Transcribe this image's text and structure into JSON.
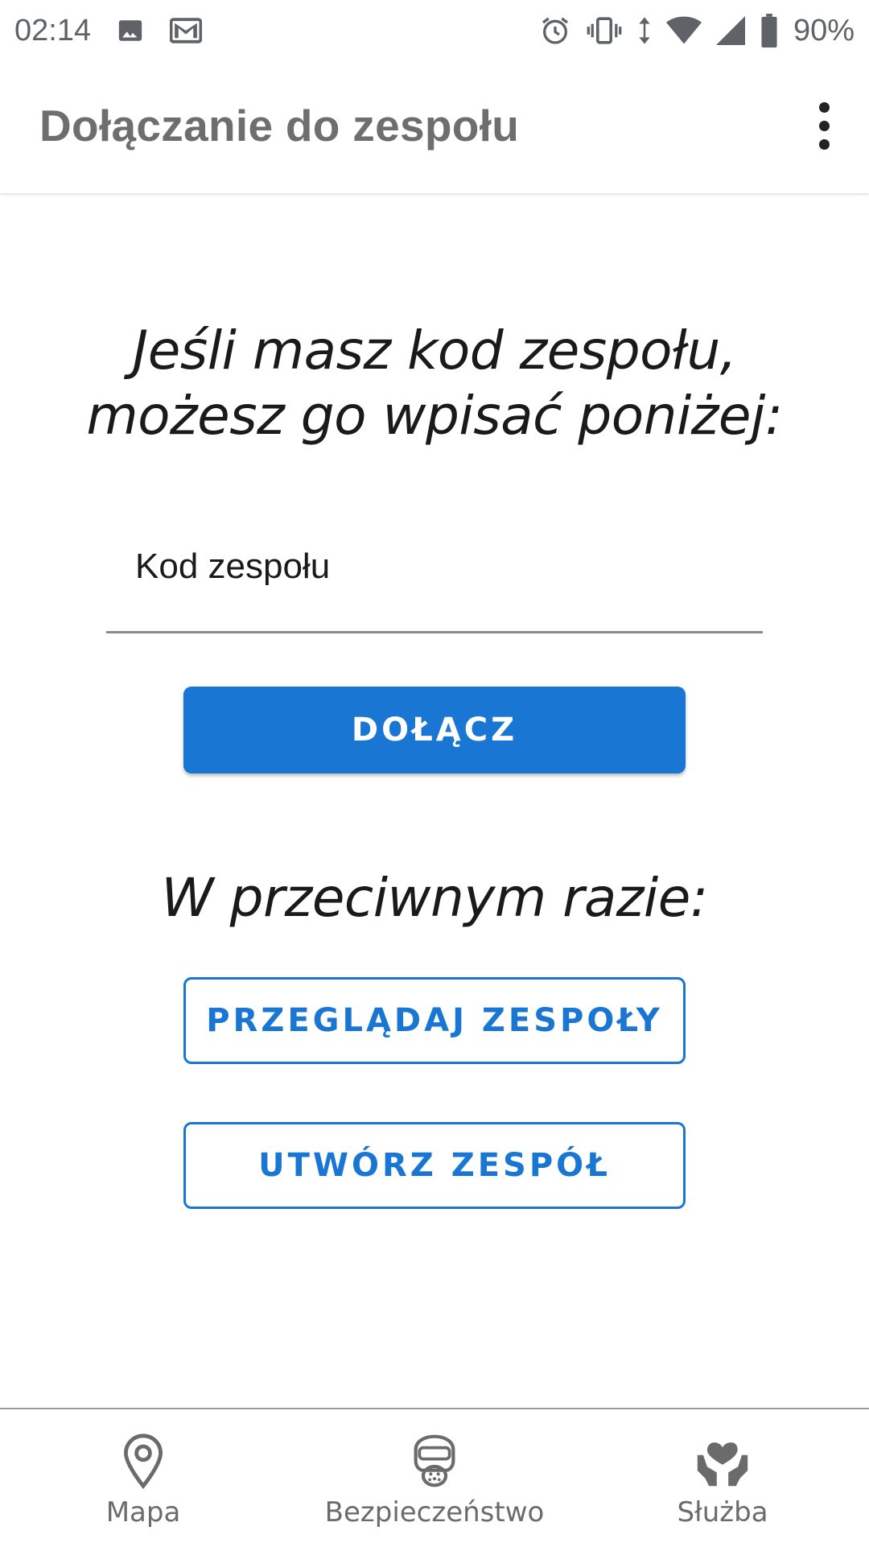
{
  "status_bar": {
    "time": "02:14",
    "battery": "90%",
    "icons": [
      "image-icon",
      "mail-icon",
      "alarm-icon",
      "vibrate-icon",
      "data-arrows-icon",
      "wifi-icon",
      "signal-icon",
      "battery-icon"
    ]
  },
  "app_bar": {
    "title": "Dołączanie do zespołu",
    "menu_icon": "more-vert-icon"
  },
  "main": {
    "intro_line1": "Jeśli masz kod zespołu,",
    "intro_line2": "możesz go wpisać poniżej:",
    "code_input": {
      "placeholder": "Kod zespołu",
      "value": ""
    },
    "join_button": "DOŁĄCZ",
    "otherwise": "W przeciwnym razie:",
    "browse_button": "PRZEGLĄDAJ ZESPOŁY",
    "create_button": "UTWÓRZ ZESPÓŁ"
  },
  "bottom_nav": {
    "items": [
      {
        "label": "Mapa",
        "icon": "map-pin-icon"
      },
      {
        "label": "Bezpieczeństwo",
        "icon": "gas-mask-icon"
      },
      {
        "label": "Służba",
        "icon": "heart-hands-icon"
      }
    ]
  },
  "colors": {
    "accent": "#1976d2",
    "title_gray": "#6e6e6e",
    "nav_gray": "#6b6b6b"
  }
}
